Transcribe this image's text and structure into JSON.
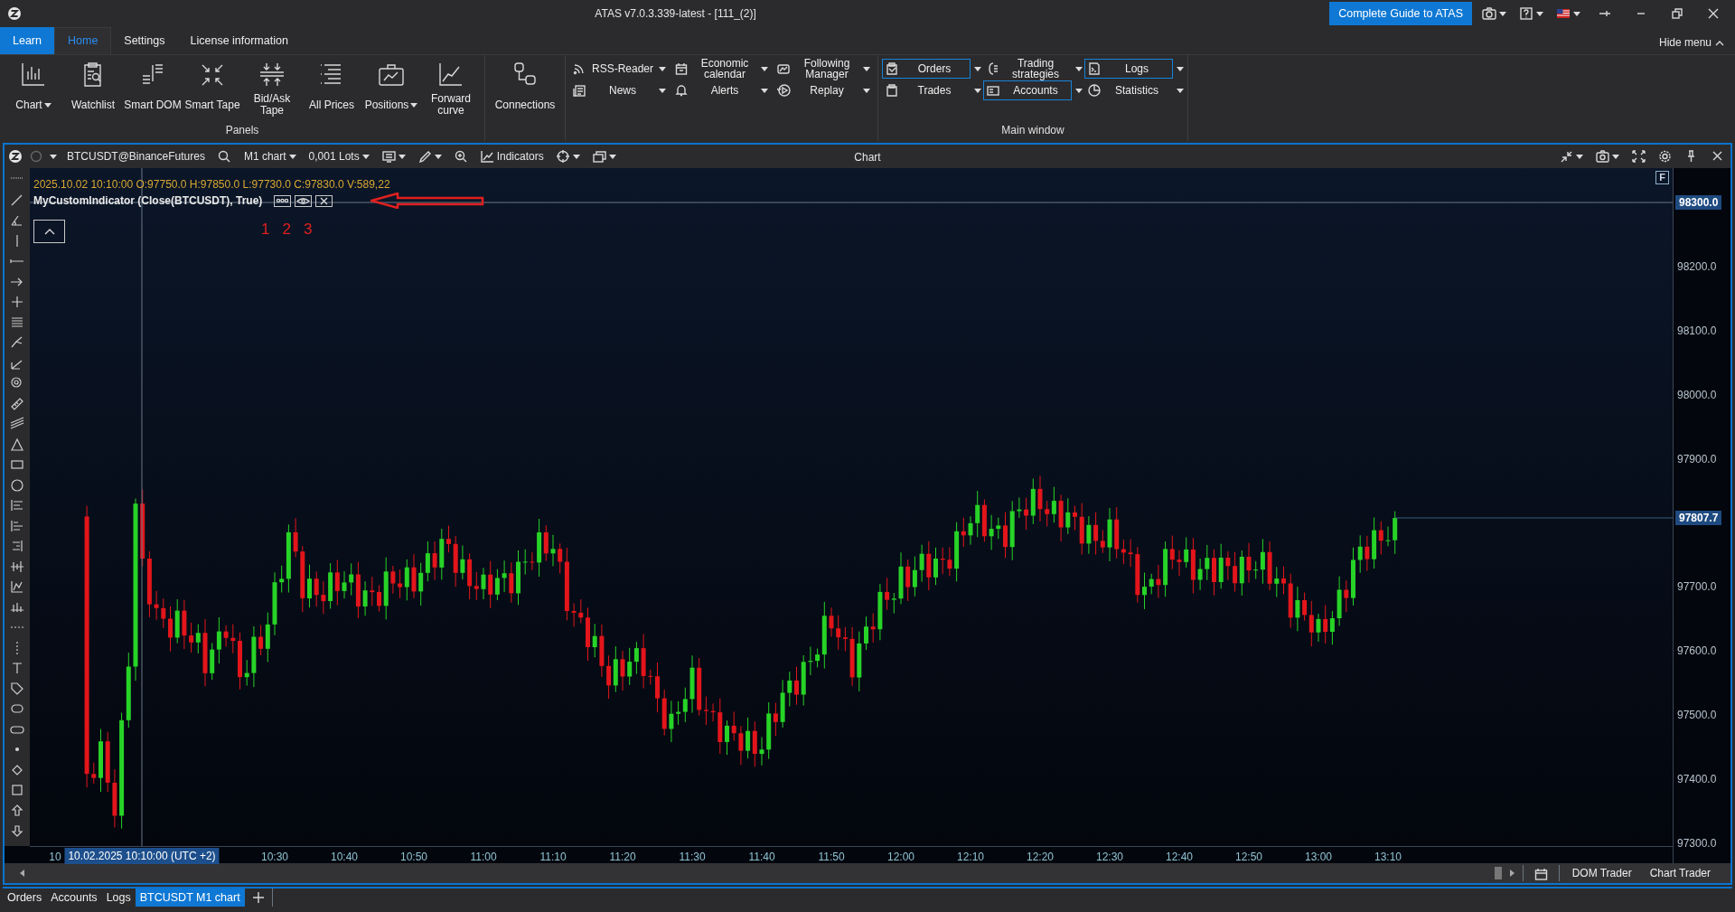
{
  "window": {
    "title": "ATAS v7.0.3.339-latest - [111_(2)]"
  },
  "title_bar": {
    "guide_button": "Complete Guide to ATAS"
  },
  "menu_tabs": [
    {
      "label": "Learn",
      "kind": "accent",
      "selected": false
    },
    {
      "label": "Home",
      "kind": "tab",
      "selected": true
    },
    {
      "label": "Settings",
      "kind": "tab",
      "selected": false
    },
    {
      "label": "License information",
      "kind": "tab",
      "selected": false
    }
  ],
  "hide_menu": "Hide menu",
  "ribbon": {
    "panels": {
      "items": [
        {
          "label": "Chart",
          "dropdown": true
        },
        {
          "label": "Watchlist",
          "dropdown": false
        },
        {
          "label": "Smart DOM",
          "dropdown": false
        },
        {
          "label": "Smart Tape",
          "dropdown": false
        },
        {
          "label": "Bid/Ask Tape",
          "dropdown": false
        },
        {
          "label": "All Prices",
          "dropdown": false
        },
        {
          "label": "Positions",
          "dropdown": true
        },
        {
          "label": "Forward curve",
          "dropdown": false
        }
      ],
      "group_label": "Panels"
    },
    "connections": {
      "label": "Connections"
    },
    "tool_columns": [
      [
        {
          "label": "RSS-Reader"
        },
        {
          "label": "News"
        }
      ],
      [
        {
          "label": "Economic calendar"
        },
        {
          "label": "Alerts"
        }
      ],
      [
        {
          "label": "Following Manager"
        },
        {
          "label": "Replay"
        }
      ]
    ],
    "main_window": {
      "columns": [
        [
          {
            "label": "Orders",
            "highlighted": true
          },
          {
            "label": "Trades",
            "highlighted": false
          }
        ],
        [
          {
            "label": "Trading strategies",
            "highlighted": false
          },
          {
            "label": "Accounts",
            "highlighted": true
          }
        ],
        [
          {
            "label": "Logs",
            "highlighted": true
          },
          {
            "label": "Statistics",
            "highlighted": false
          }
        ]
      ],
      "group_label": "Main window"
    }
  },
  "chart_window": {
    "symbol": "BTCUSDT@BinanceFutures",
    "timeframe": "M1 chart",
    "lots": "0,001 Lots",
    "indicators": "Indicators",
    "title": "Chart",
    "ohlc": "2025.10.02 10:10:00 O:97750.0 H:97850.0 L:97730.0 C:97830.0 V:589,22",
    "indicator_label": "MyCustomIndicator (Close(BTCUSDT), True)",
    "annotation_numbers": [
      "1",
      "2",
      "3"
    ],
    "corner_badge": "F",
    "crosshair_price": "98300.0",
    "last_price": "97807.7",
    "price_labels": [
      "98200.0",
      "98100.0",
      "98000.0",
      "97900.0",
      "97700.0",
      "97600.0",
      "97500.0",
      "97400.0",
      "97300.0"
    ],
    "time_labels": [
      "10",
      "10:30",
      "10:40",
      "10:50",
      "11:00",
      "11:10",
      "11:20",
      "11:30",
      "11:40",
      "11:50",
      "12:00",
      "12:10",
      "12:20",
      "12:30",
      "12:40",
      "12:50",
      "13:00",
      "13:10"
    ],
    "crosshair_time": "10.02.2025 10:10:00 (UTC +2)",
    "footer_buttons": [
      "DOM Trader",
      "Chart Trader"
    ]
  },
  "bottom_tabs": [
    {
      "label": "Orders",
      "selected": false
    },
    {
      "label": "Accounts",
      "selected": false
    },
    {
      "label": "Logs",
      "selected": false
    },
    {
      "label": "BTCUSDT M1 chart",
      "selected": true
    }
  ]
}
